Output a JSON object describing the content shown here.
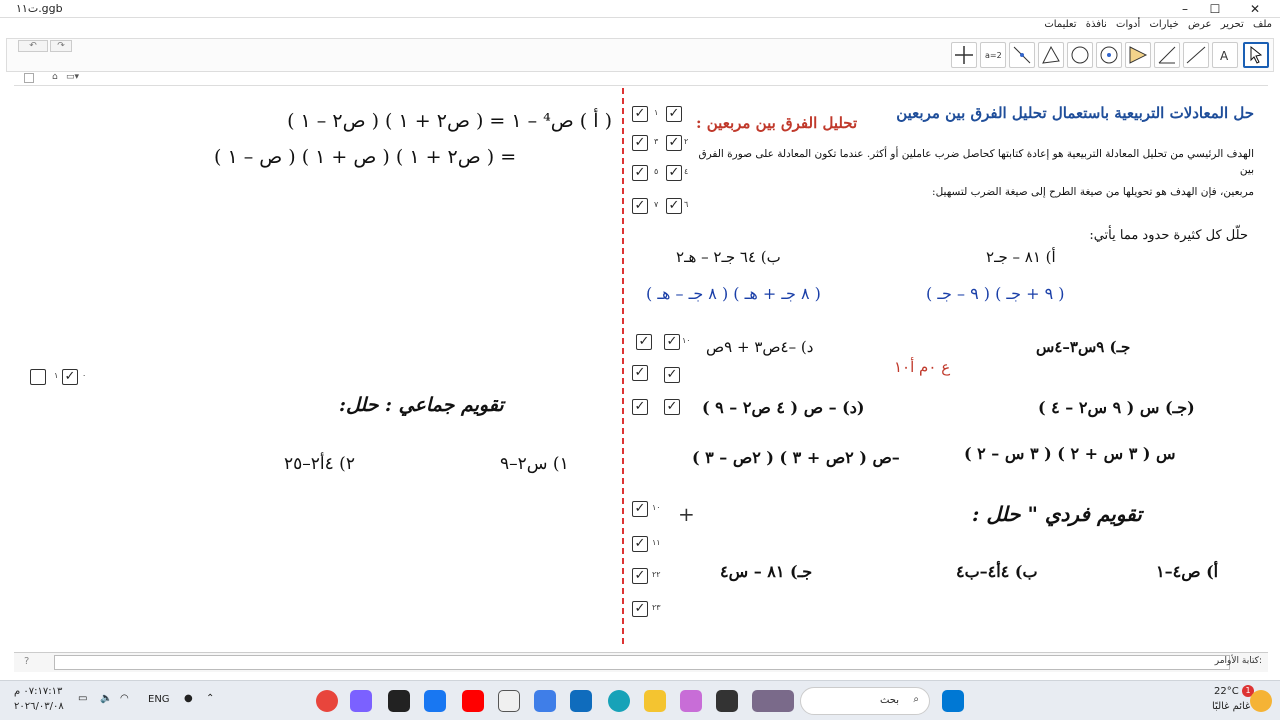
{
  "window": {
    "title": "ت١١.ggb",
    "min": "–",
    "max": "☐",
    "close": "✕"
  },
  "menu": [
    "ملف",
    "تحرير",
    "عرض",
    "خيارات",
    "أدوات",
    "نافذة",
    "تعليمات"
  ],
  "toolbar": {
    "undo": "↶",
    "redo": "↷"
  },
  "left": {
    "eq1": "( أ ) ص⁴ – ١ = ( ص٢ + ١ ) ( ص٢ – ١ )",
    "eq2": "= ( ص٢ + ١ ) ( ص + ١ ) ( ص – ١ )",
    "checkbox_label": "٠",
    "checkbox2_label": "١",
    "heading": "تقويم جماعي : حلل:",
    "ex1": "١) س٢–٩",
    "ex2": "٢) ٤أ٢–٢٥"
  },
  "right": {
    "title": "حل المعادلات التربيعية باستعمال تحليل الفرق بين مربعين",
    "subtitle": "تحليل الفرق بين مربعين :",
    "para1": "الهدف الرئيسي من تحليل المعادلة التربيعية هو إعادة كتابتها كحاصل ضرب عاملين أو أكثر. عندما تكون المعادلة على صورة الفرق بين",
    "para2": "مربعين، فإن الهدف هو تحويلها من صيغة الطرح إلى صيغة الضرب لتسهيل:",
    "instruction": "حلّل كل كثيرة حدود مما يأتي:",
    "a_label": "أ) ٨١ – جـ٢",
    "b_label": "ب) ٦٤ جـ٢ – هـ٢",
    "a_sol": "( ٩ + جـ ) ( ٩ – جـ )",
    "b_sol": "( ٨ جـ + هـ ) ( ٨ جـ – هـ )",
    "c_label": "جـ) ٩س٣–٤س",
    "d_label": "د) –٤ص٣ + ٩ص",
    "note": "ع ٠م أ١٠",
    "c_sol1": "(جـ) س ( ٩ س٢ – ٤ )",
    "d_sol1": "(د) – ص ( ٤ ص٢ – ٩ )",
    "c_sol2": "س ( ٣ س + ٢ ) ( ٣ س – ٢ )",
    "d_sol2": "–ص ( ٢ص + ٣ ) ( ٢ص – ٣ )",
    "individual": "تقويم فردي \" حلل :",
    "q_a": "أ) ص٤–١",
    "q_b": "ب) ٤أ٤–ب٤",
    "q_c": "جـ) ٨١ – س٤",
    "checks": [
      "١",
      "٣",
      "٥",
      "٧",
      "٢",
      "٤",
      "٦",
      "٨",
      "١٠",
      "١١",
      "٢٢",
      "٢٣"
    ]
  },
  "cmd": {
    "label": "كتابة الأوامر:"
  },
  "taskbar": {
    "search": "بحث",
    "weather_temp": "22°C",
    "weather_desc": "غائم غالبًا",
    "lang": "ENG",
    "time": "٠٧:١٧:١٣ م",
    "date": "٢٠٢٦/٠٣/٠٨",
    "notif": "1"
  }
}
